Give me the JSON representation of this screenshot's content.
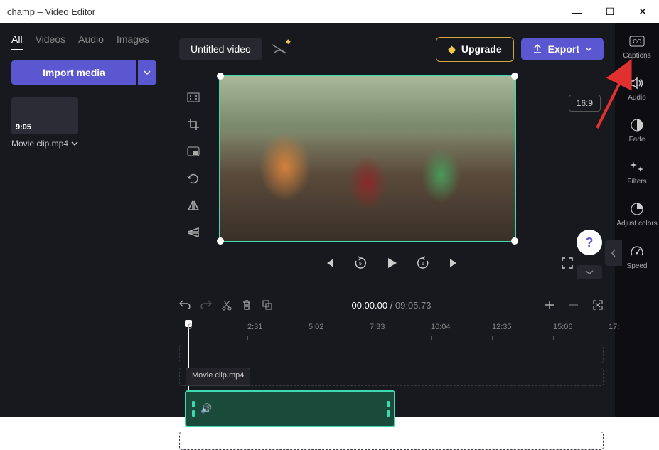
{
  "window": {
    "title": "champ – Video Editor",
    "minimize": "—",
    "maximize": "☐",
    "close": "✕"
  },
  "tabs": {
    "all": "All",
    "videos": "Videos",
    "audio": "Audio",
    "images": "Images"
  },
  "import": {
    "label": "Import media"
  },
  "media": {
    "duration": "9:05",
    "name": "Movie clip.mp4"
  },
  "project": {
    "title": "Untitled video"
  },
  "actions": {
    "upgrade": "Upgrade",
    "export": "Export"
  },
  "aspect": "16:9",
  "timecode": {
    "current": "00:00.00",
    "total": "09:05.73"
  },
  "ruler": {
    "t0": "0",
    "t1": "2:31",
    "t2": "5:02",
    "t3": "7:33",
    "t4": "10:04",
    "t5": "12:35",
    "t6": "15:06",
    "t7": "17:"
  },
  "timeline": {
    "clipName": "Movie clip.mp4"
  },
  "rightSidebar": {
    "captions": "Captions",
    "audio": "Audio",
    "fade": "Fade",
    "filters": "Filters",
    "adjust": "Adjust colors",
    "speed": "Speed"
  },
  "help": "?"
}
